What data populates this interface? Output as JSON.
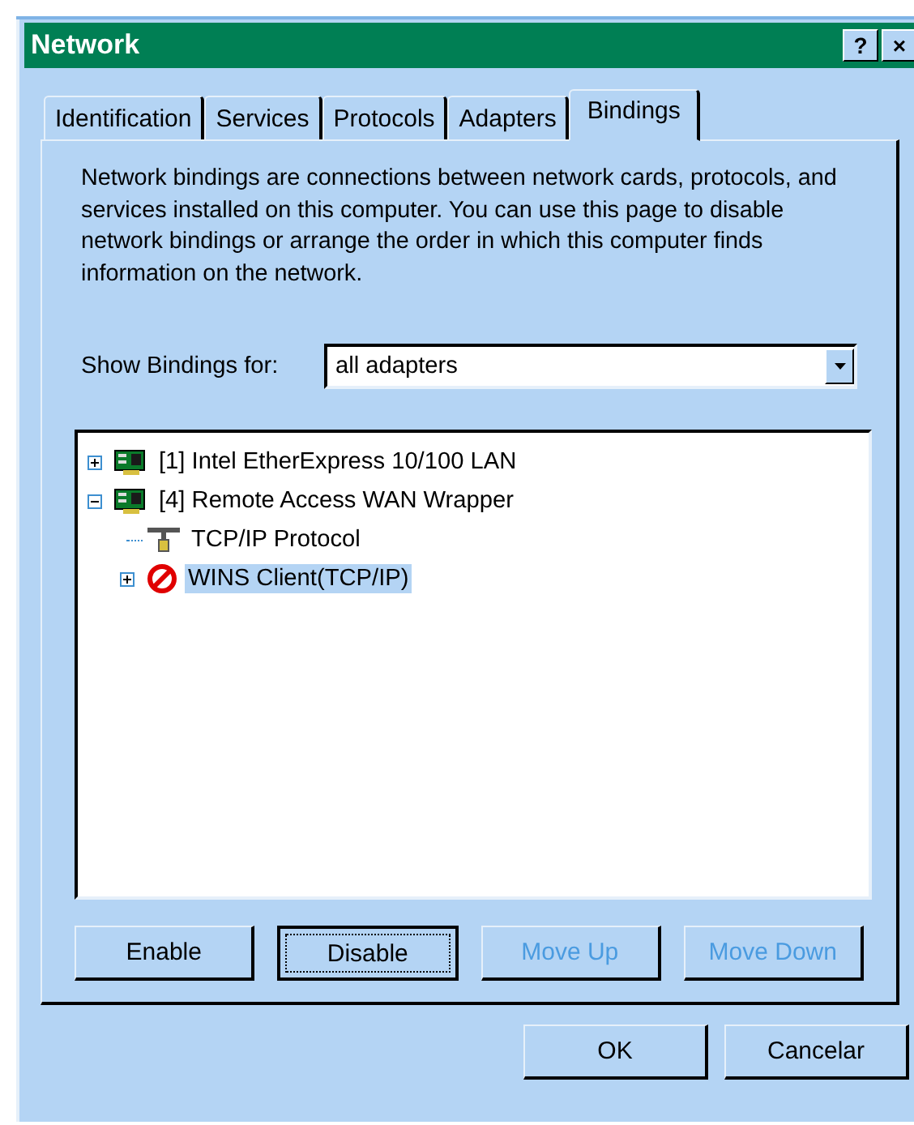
{
  "window": {
    "title": "Network",
    "help_button": "?",
    "close_button": "×"
  },
  "tabs": [
    {
      "label": "Identification",
      "selected": false
    },
    {
      "label": "Services",
      "selected": false
    },
    {
      "label": "Protocols",
      "selected": false
    },
    {
      "label": "Adapters",
      "selected": false
    },
    {
      "label": "Bindings",
      "selected": true
    }
  ],
  "description": "Network bindings are connections between network cards, protocols, and services installed on this computer.  You can use this page to disable network bindings or arrange the order in which this computer finds information on the network.",
  "show_bindings": {
    "label": "Show Bindings for:",
    "value": "all adapters"
  },
  "tree": [
    {
      "kind": "adapter",
      "label": "[1] Intel EtherExpress 10/100 LAN",
      "expanded": false,
      "selected": false
    },
    {
      "kind": "adapter",
      "label": "[4] Remote Access WAN Wrapper",
      "expanded": true,
      "selected": false,
      "children": [
        {
          "kind": "protocol",
          "label": "TCP/IP Protocol",
          "selected": false
        },
        {
          "kind": "disabled",
          "label": "WINS Client(TCP/IP)",
          "expanded": false,
          "selected": true
        }
      ]
    }
  ],
  "actions": [
    {
      "label": "Enable",
      "disabled": false,
      "focused": false
    },
    {
      "label": "Disable",
      "disabled": false,
      "focused": true
    },
    {
      "label": "Move Up",
      "disabled": true,
      "focused": false
    },
    {
      "label": "Move Down",
      "disabled": true,
      "focused": false
    }
  ],
  "buttons": [
    {
      "label": "OK"
    },
    {
      "label": "Cancelar"
    }
  ]
}
